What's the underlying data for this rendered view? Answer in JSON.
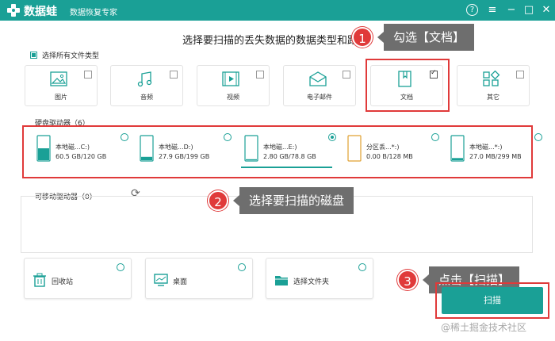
{
  "titlebar": {
    "app_name": "数据蛙",
    "subtitle": "数据恢复专家",
    "help_icon": "?",
    "menu_icon": "≡",
    "minimize_icon": "−",
    "maximize_icon": "□",
    "close_icon": "✕"
  },
  "main_title": "选择要扫描的丢失数据的数据类型和路径",
  "select_all_label": "选择所有文件类型",
  "file_types": [
    {
      "label": "图片",
      "icon": "picture-icon",
      "checked": false
    },
    {
      "label": "音频",
      "icon": "music-icon",
      "checked": false
    },
    {
      "label": "视频",
      "icon": "video-icon",
      "checked": false
    },
    {
      "label": "电子邮件",
      "icon": "email-icon",
      "checked": false
    },
    {
      "label": "文档",
      "icon": "document-icon",
      "checked": true
    },
    {
      "label": "其它",
      "icon": "other-icon",
      "checked": false
    }
  ],
  "hard_drives": {
    "label": "硬盘驱动器（6）",
    "items": [
      {
        "name": "本地磁...C:)",
        "size": "60.5 GB/120 GB",
        "selected": false,
        "fill": 0.5
      },
      {
        "name": "本地磁...D:)",
        "size": "27.9 GB/199 GB",
        "selected": false,
        "fill": 0.14
      },
      {
        "name": "本地磁...E:)",
        "size": "2.80 GB/78.8 GB",
        "selected": true,
        "fill": 0.04
      },
      {
        "name": "分区丢...*:)",
        "size": "0.00  B/128 MB",
        "selected": false,
        "fill": 0
      },
      {
        "name": "本地磁...*:)",
        "size": "27.0 MB/299 MB",
        "selected": false,
        "fill": 0.09
      }
    ]
  },
  "removable_drives": {
    "label": "可移动驱动器（0）",
    "refresh_icon": "⟳"
  },
  "locations": [
    {
      "label": "回收站",
      "icon": "recycle-bin-icon"
    },
    {
      "label": "桌面",
      "icon": "desktop-icon"
    },
    {
      "label": "选择文件夹",
      "icon": "folder-icon"
    }
  ],
  "callouts": [
    {
      "num": "1",
      "text": "勾选【文档】"
    },
    {
      "num": "2",
      "text": "选择要扫描的磁盘"
    },
    {
      "num": "3",
      "text": "点击【扫描】"
    }
  ],
  "scan_button": "扫描",
  "watermark": "@稀土掘金技术社区",
  "colors": {
    "accent": "#1aa096",
    "highlight": "#e03a3a",
    "callout": "#6e6e6e"
  }
}
